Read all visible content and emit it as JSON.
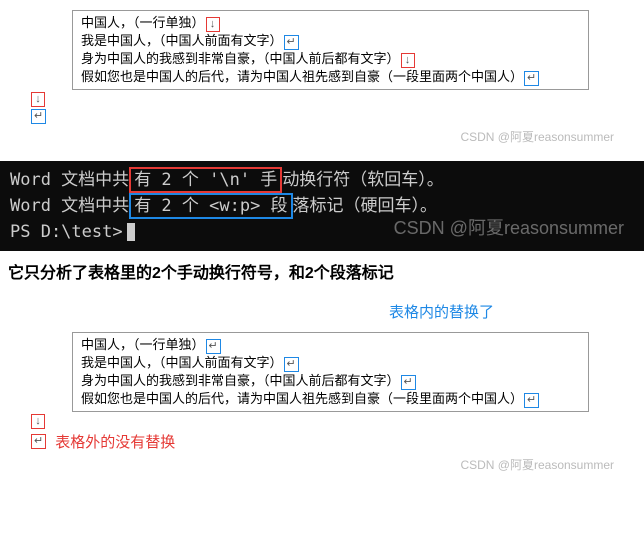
{
  "table1": {
    "line1": "中国人，（一行单独）",
    "line2": "我是中国人，（中国人前面有文字）",
    "line3": "身为中国人的我感到非常自豪，（中国人前后都有文字）",
    "line4": "假如您也是中国人的后代，请为中国人祖先感到自豪（一段里面两个中国人）"
  },
  "table2": {
    "line1": "中国人，（一行单独）",
    "line2": "我是中国人，（中国人前面有文字）",
    "line3": "身为中国人的我感到非常自豪，（中国人前后都有文字）",
    "line4": "假如您也是中国人的后代，请为中国人祖先感到自豪（一段里面两个中国人）"
  },
  "marks": {
    "down_arrow": "↓",
    "return": "↵"
  },
  "terminal": {
    "line1_pre": "Word 文档中共",
    "line1_hl": "有 2 个 '\\n' 手",
    "line1_post": "动换行符（软回车）。",
    "line2_pre": "Word 文档中共",
    "line2_hl": "有 2 个 <w:p> 段",
    "line2_post": "落标记（硬回车）。",
    "line3": "PS D:\\test>"
  },
  "bold_note": "它只分析了表格里的2个手动换行符号，和2个段落标记",
  "labels": {
    "inside_replaced": "表格内的替换了",
    "outside_not_replaced": "表格外的没有替换"
  },
  "watermark": "CSDN @阿夏reasonsummer"
}
